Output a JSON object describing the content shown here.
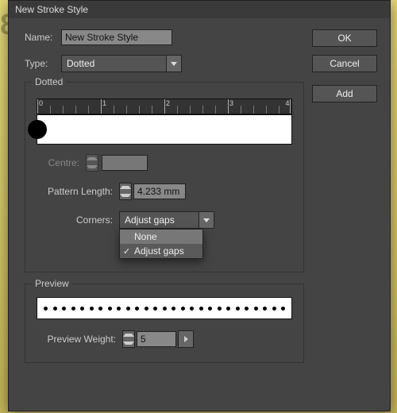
{
  "dialog": {
    "title": "New Stroke Style"
  },
  "buttons": {
    "ok": "OK",
    "cancel": "Cancel",
    "add": "Add"
  },
  "fields": {
    "name_label": "Name:",
    "name_value": "New Stroke Style",
    "type_label": "Type:",
    "type_value": "Dotted"
  },
  "dotted": {
    "title": "Dotted",
    "ruler_ticks": [
      "0",
      "1",
      "2",
      "3",
      "4"
    ],
    "centre_label": "Centre:",
    "pattern_length_label": "Pattern Length:",
    "pattern_length_value": "4.233 mm",
    "corners_label": "Corners:",
    "corners_value": "Adjust gaps",
    "corners_options": {
      "none": "None",
      "adjust_gaps": "Adjust gaps"
    }
  },
  "preview": {
    "title": "Preview",
    "weight_label": "Preview Weight:",
    "weight_value": "5"
  }
}
